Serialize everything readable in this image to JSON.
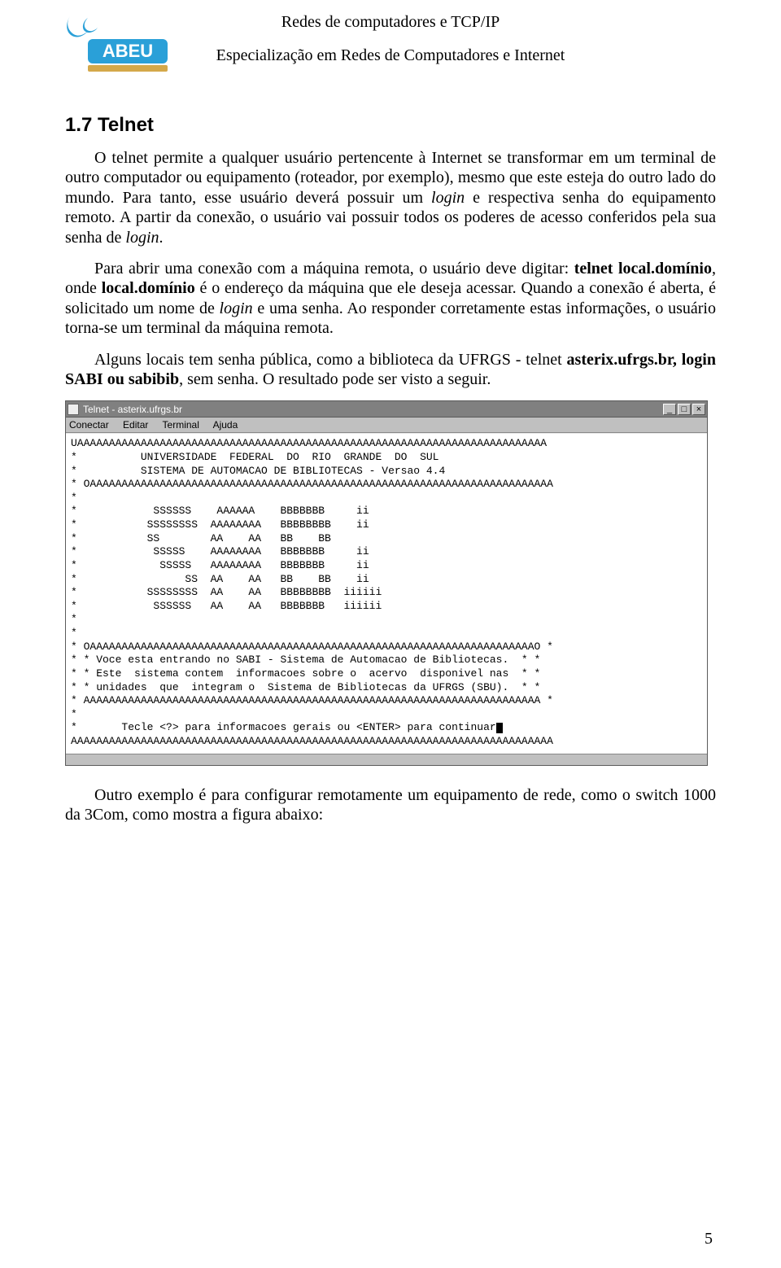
{
  "header": {
    "title1": "Redes de computadores e TCP/IP",
    "title2": "Especialização em Redes de Computadores e Internet",
    "logo_text": "ABEU"
  },
  "section": {
    "heading": "1.7 Telnet"
  },
  "paragraphs": {
    "p1_a": "O telnet permite a qualquer usuário pertencente à Internet se transformar em um terminal de outro computador ou equipamento (roteador, por exemplo), mesmo que este esteja do outro lado do mundo. Para tanto, esse usuário deverá possuir um ",
    "p1_login": "login",
    "p1_b": " e respectiva senha do equipamento remoto. A partir da conexão, o usuário vai possuir todos os poderes de acesso conferidos pela sua senha de ",
    "p1_c": ".",
    "p2_a": "Para abrir uma conexão com a máquina remota, o usuário deve digitar: ",
    "p2_b": "telnet local.domínio",
    "p2_c": ", onde ",
    "p2_d": "local.domínio",
    "p2_e": " é o endereço da máquina que ele deseja acessar. Quando a conexão é aberta, é solicitado um nome de ",
    "p2_f": "login",
    "p2_g": " e uma senha. Ao responder corretamente estas informações, o usuário torna-se um terminal da máquina remota.",
    "p3_a": "Alguns locais tem senha pública, como a biblioteca da UFRGS - telnet ",
    "p3_b": "asterix.ufrgs.br, login SABI ou sabibib",
    "p3_c": ", sem senha. O resultado pode ser visto a seguir.",
    "p4": "Outro exemplo é para configurar remotamente um equipamento de rede, como o switch 1000 da 3Com, como mostra a figura abaixo:"
  },
  "telnet": {
    "title": "Telnet - asterix.ufrgs.br",
    "menu": {
      "m1": "Conectar",
      "m2": "Editar",
      "m3": "Terminal",
      "m4": "Ajuda"
    },
    "win_min": "_",
    "win_max": "□",
    "win_close": "×",
    "lines": {
      "top": "UAAAAAAAAAAAAAAAAAAAAAAAAAAAAAAAAAAAAAAAAAAAAAAAAAAAAAAAAAAAAAAAAAAAAAAAAAA",
      "l1": "*          UNIVERSIDADE  FEDERAL  DO  RIO  GRANDE  DO  SUL",
      "l2": "*          SISTEMA DE AUTOMACAO DE BIBLIOTECAS - Versao 4.4",
      "sep": "* OAAAAAAAAAAAAAAAAAAAAAAAAAAAAAAAAAAAAAAAAAAAAAAAAAAAAAAAAAAAAAAAAAAAAAAAAA",
      "a1": "*            SSSSSS    AAAAAA    BBBBBBB     ii",
      "a2": "*           SSSSSSSS  AAAAAAAA   BBBBBBBB    ii",
      "a3": "*           SS        AA    AA   BB    BB",
      "a4": "*            SSSSS    AAAAAAAA   BBBBBBB     ii",
      "a5": "*             SSSSS   AAAAAAAA   BBBBBBB     ii",
      "a6": "*                 SS  AA    AA   BB    BB    ii",
      "a7": "*           SSSSSSSS  AA    AA   BBBBBBBB  iiiiii",
      "a8": "*            SSSSSS   AA    AA   BBBBBBB   iiiiii",
      "b0": "* OAAAAAAAAAAAAAAAAAAAAAAAAAAAAAAAAAAAAAAAAAAAAAAAAAAAAAAAAAAAAAAAAAAAAAAO *",
      "b1": "* * Voce esta entrando no SABI - Sistema de Automacao de Bibliotecas.  * *",
      "b2": "* * Este  sistema contem  informacoes sobre o  acervo  disponivel nas  * *",
      "b3": "* * unidades  que  integram o  Sistema de Bibliotecas da UFRGS (SBU).  * *",
      "b4": "* AAAAAAAAAAAAAAAAAAAAAAAAAAAAAAAAAAAAAAAAAAAAAAAAAAAAAAAAAAAAAAAAAAAAAAAA *",
      "c1": "*       Tecle <?> para informacoes gerais ou <ENTER> para continuar",
      "c2": "AAAAAAAAAAAAAAAAAAAAAAAAAAAAAAAAAAAAAAAAAAAAAAAAAAAAAAAAAAAAAAAAAAAAAAAAAAAA"
    }
  },
  "page_number": "5"
}
